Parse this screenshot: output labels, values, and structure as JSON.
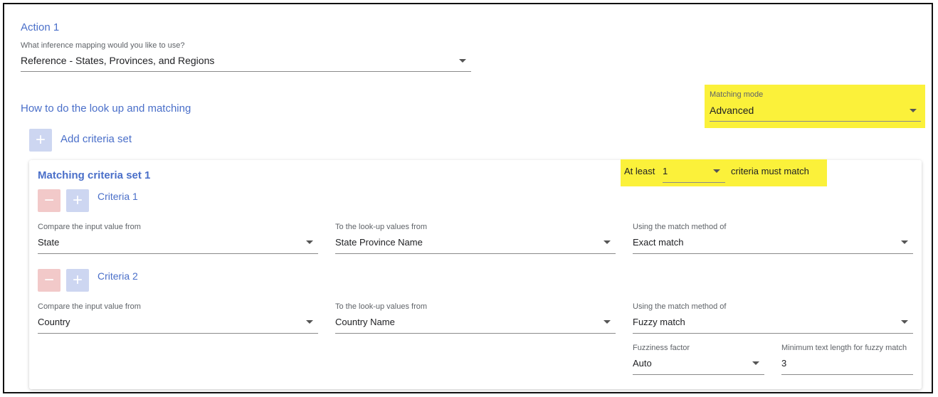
{
  "action": {
    "title": "Action 1",
    "mapping_label": "What inference mapping would you like to use?",
    "mapping_value": "Reference - States, Provinces, and Regions"
  },
  "lookup": {
    "heading": "How to do the look up and matching",
    "matching_mode_label": "Matching mode",
    "matching_mode_value": "Advanced",
    "add_criteria_label": "Add criteria set"
  },
  "criteria_set": {
    "title": "Matching criteria set 1",
    "at_least_label": "At least",
    "at_least_value": "1",
    "must_match_label": "criteria must match",
    "criteria": [
      {
        "title": "Criteria 1",
        "input_label": "Compare the input value from",
        "input_value": "State",
        "lookup_label": "To the look-up values from",
        "lookup_value": "State Province Name",
        "method_label": "Using the match method of",
        "method_value": "Exact match"
      },
      {
        "title": "Criteria 2",
        "input_label": "Compare the input value from",
        "input_value": "Country",
        "lookup_label": "To the look-up values from",
        "lookup_value": "Country Name",
        "method_label": "Using the match method of",
        "method_value": "Fuzzy match",
        "fuzziness_label": "Fuzziness factor",
        "fuzziness_value": "Auto",
        "min_length_label": "Minimum text length for fuzzy match",
        "min_length_value": "3"
      }
    ]
  },
  "colors": {
    "accent": "#4a6fc9",
    "highlight": "#fbf13a",
    "add_button": "#cdd6f1",
    "remove_button": "#f2c9c9"
  },
  "icons": [
    "plus-icon",
    "minus-icon",
    "dropdown-caret-icon"
  ]
}
